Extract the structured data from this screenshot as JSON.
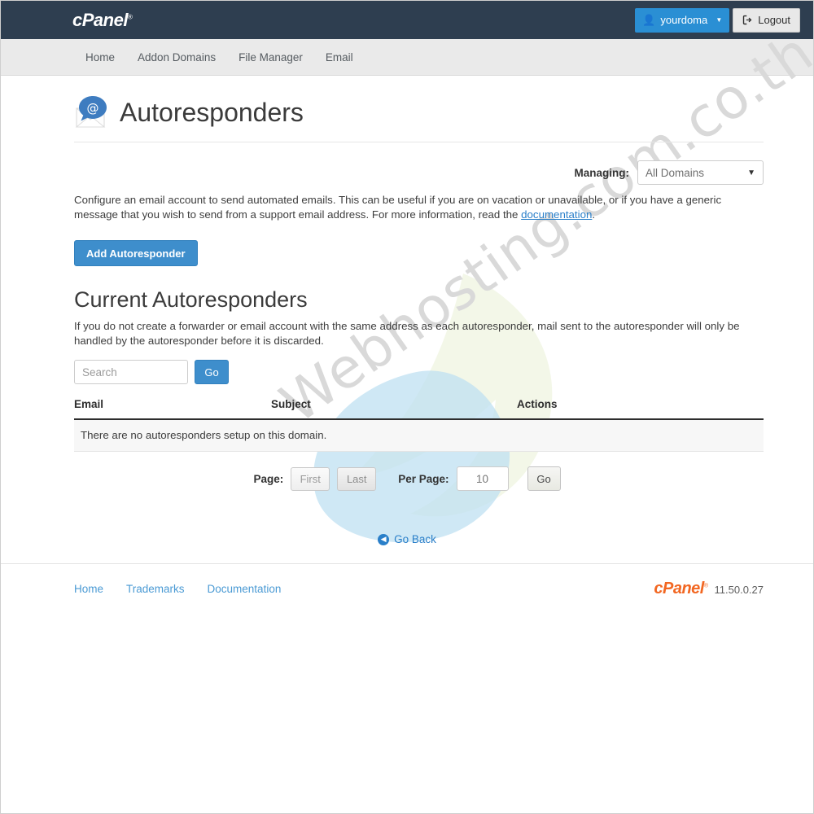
{
  "topbar": {
    "logo": "cPanel",
    "logo_registered": "®",
    "user_button": "yourdoma",
    "user_icon": "person-icon",
    "caret_icon": "caret-down-icon",
    "logout_button": "Logout",
    "logout_icon": "logout-icon",
    "bg_color": "#2e3e50",
    "user_btn_color": "#2a8fd4"
  },
  "nav": {
    "items": [
      {
        "label": "Home"
      },
      {
        "label": "Addon Domains"
      },
      {
        "label": "File Manager"
      },
      {
        "label": "Email"
      }
    ]
  },
  "header": {
    "title": "Autoresponders",
    "icon": "envelope-at-icon"
  },
  "managing": {
    "label": "Managing:",
    "selected": "All Domains",
    "options": [
      "All Domains"
    ],
    "caret_icon": "caret-down-icon"
  },
  "description": {
    "text_before_link": "Configure an email account to send automated emails. This can be useful if you are on vacation or unavailable, or if you have a generic message that you wish to send from a support email address. For more information, read the ",
    "link_text": "documentation",
    "text_after_link": "."
  },
  "actions": {
    "add_autoresponder": "Add Autoresponder",
    "accent_color": "#3e8ecc"
  },
  "current_section": {
    "title": "Current Autoresponders",
    "description": "If you do not create a forwarder or email account with the same address as each autoresponder, mail sent to the autoresponder will only be handled by the autoresponder before it is discarded."
  },
  "search": {
    "value": "",
    "placeholder": "Search",
    "go_label": "Go"
  },
  "table": {
    "columns": [
      "Email",
      "Subject",
      "Actions"
    ],
    "rows": [],
    "empty_message": "There are no autoresponders setup on this domain."
  },
  "pagination": {
    "page_label": "Page:",
    "first_label": "First",
    "last_label": "Last",
    "per_page_label": "Per Page:",
    "per_page_value": "10",
    "go_label": "Go"
  },
  "go_back": {
    "label": "Go Back",
    "icon": "circle-arrow-left-icon"
  },
  "footer": {
    "links": [
      {
        "label": "Home"
      },
      {
        "label": "Trademarks"
      },
      {
        "label": "Documentation"
      }
    ],
    "logo": "cPanel",
    "logo_registered": "®",
    "version": "11.50.0.27",
    "logo_color": "#f26722"
  },
  "watermark": {
    "text": "Webhosting.com.co.th"
  }
}
